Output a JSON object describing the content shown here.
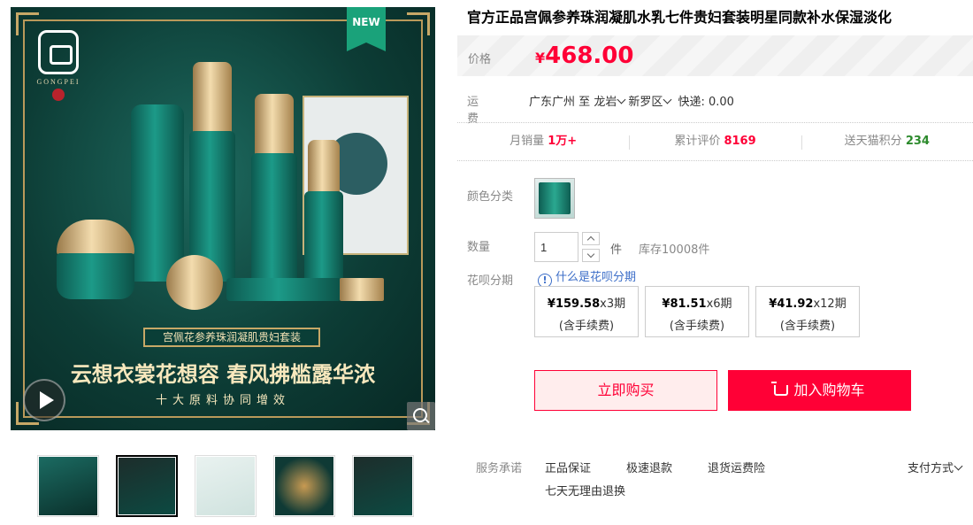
{
  "product": {
    "title": "官方正品宫佩参养珠润凝肌水乳七件贵妇套装明星同款补水保湿淡化"
  },
  "gallery": {
    "badge": "NEW",
    "brand_word": "GONGPEI",
    "banner_text": "宫佩花参养珠润凝肌贵妇套装",
    "slogan": "云想衣裳花想容 春风拂槛露华浓",
    "sub_slogan": "十大原料协同增效",
    "thumbnails": [
      "thumb-1",
      "thumb-2",
      "thumb-3",
      "thumb-4",
      "thumb-5"
    ],
    "active_thumbnail": 1
  },
  "price": {
    "label": "价格",
    "currency": "¥",
    "value": "468.00",
    "color": "#ff0036"
  },
  "shipping": {
    "label": "运费",
    "from": "广东广州",
    "to_word": "至",
    "city": "龙岩",
    "district": "新罗区",
    "fee_text": "快递: 0.00"
  },
  "stats": {
    "monthly_sales_label": "月销量",
    "monthly_sales_value": "1万+",
    "reviews_label": "累计评价",
    "reviews_value": "8169",
    "points_label": "送天猫积分",
    "points_value": "234"
  },
  "color": {
    "label": "颜色分类"
  },
  "quantity": {
    "label": "数量",
    "value": "1",
    "unit": "件",
    "stock": "库存10008件"
  },
  "huabei": {
    "label": "花呗分期",
    "help": "什么是花呗分期",
    "options": [
      {
        "amount": "¥159.58",
        "periods": "x3期",
        "fee": "(含手续费)"
      },
      {
        "amount": "¥81.51",
        "periods": "x6期",
        "fee": "(含手续费)"
      },
      {
        "amount": "¥41.92",
        "periods": "x12期",
        "fee": "(含手续费)"
      }
    ]
  },
  "actions": {
    "buy_now": "立即购买",
    "add_to_cart": "加入购物车"
  },
  "service": {
    "label": "服务承诺",
    "items": [
      "正品保证",
      "极速退款",
      "退货运费险",
      "七天无理由退换"
    ],
    "payment": "支付方式"
  }
}
